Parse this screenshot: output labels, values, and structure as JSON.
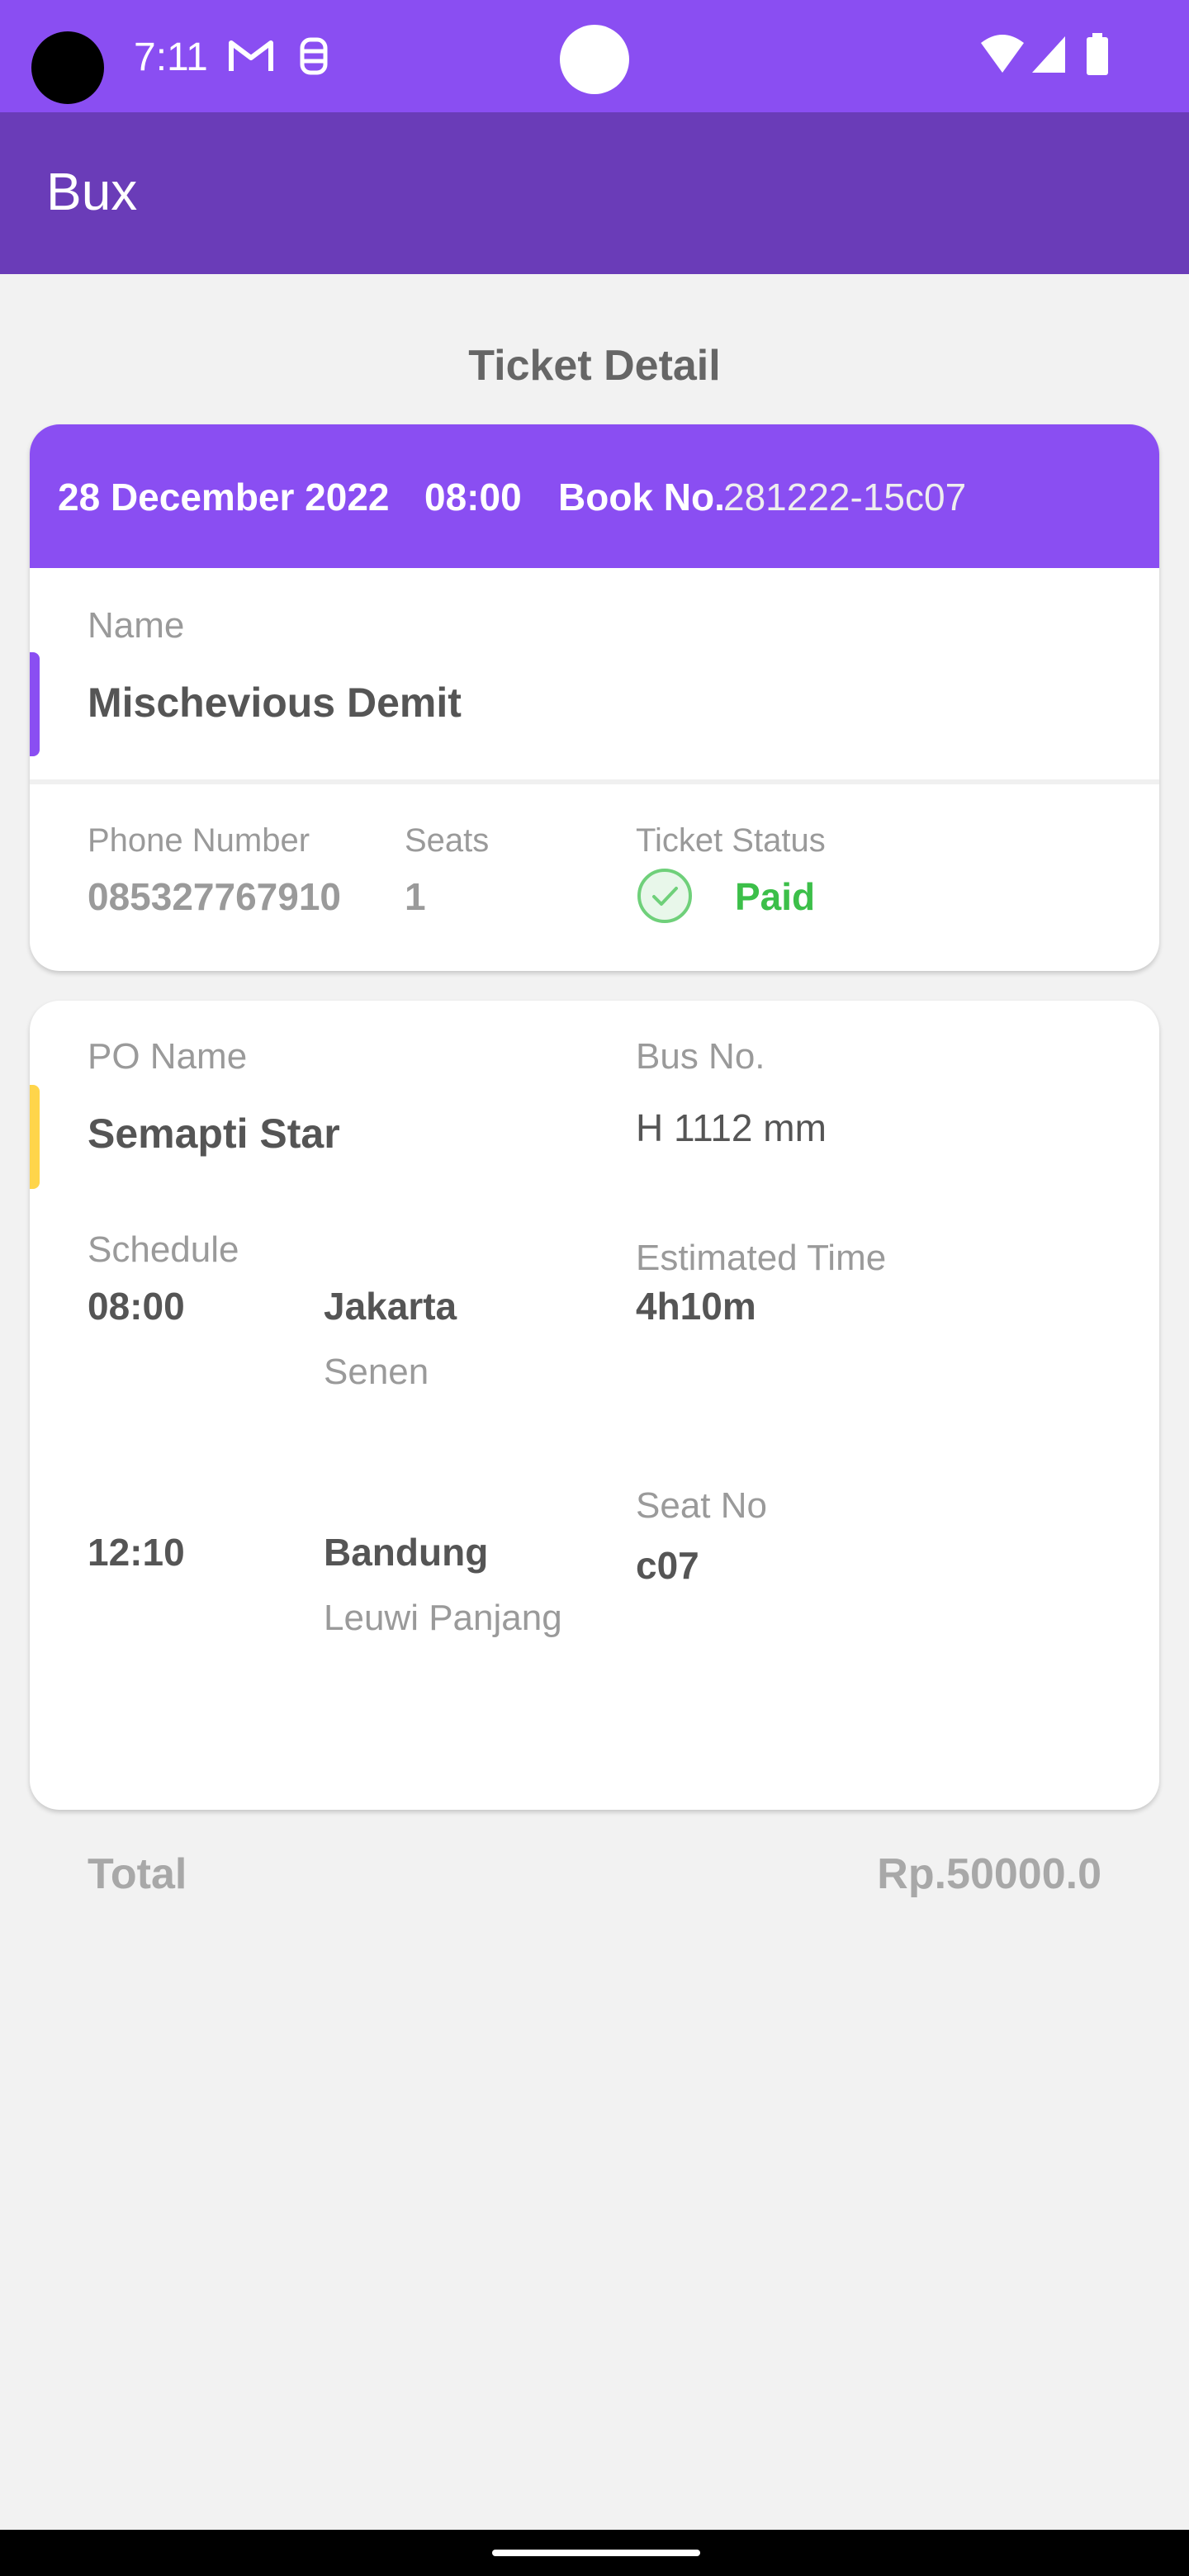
{
  "status_bar": {
    "time": "7:11",
    "icons": [
      "gmail-icon",
      "notification-icon",
      "wifi-icon",
      "signal-icon",
      "battery-icon"
    ],
    "color": "#8a4ef2"
  },
  "app_bar": {
    "title": "Bux",
    "color": "#6a3cb8"
  },
  "page": {
    "title": "Ticket Detail"
  },
  "ticket": {
    "date": "28 December 2022",
    "time": "08:00",
    "book_label": "Book No.",
    "book_no": "281222-15c07",
    "name_label": "Name",
    "name": "Mischevious Demit",
    "phone_label": "Phone Number",
    "phone": "085327767910",
    "seats_label": "Seats",
    "seats": "1",
    "status_label": "Ticket Status",
    "status": "Paid",
    "status_color": "#3cbf49"
  },
  "trip": {
    "po_label": "PO Name",
    "po_name": "Semapti Star",
    "bus_label": "Bus No.",
    "bus_no": "H 1112 mm",
    "schedule_label": "Schedule",
    "departure": {
      "time": "08:00",
      "city": "Jakarta",
      "terminal": "Senen"
    },
    "arrival": {
      "time": "12:10",
      "city": "Bandung",
      "terminal": "Leuwi Panjang"
    },
    "estimated_label": "Estimated Time",
    "estimated": "4h10m",
    "seat_label": "Seat No",
    "seat_no": "c07"
  },
  "summary": {
    "total_label": "Total",
    "total_value": "Rp.50000.0"
  }
}
